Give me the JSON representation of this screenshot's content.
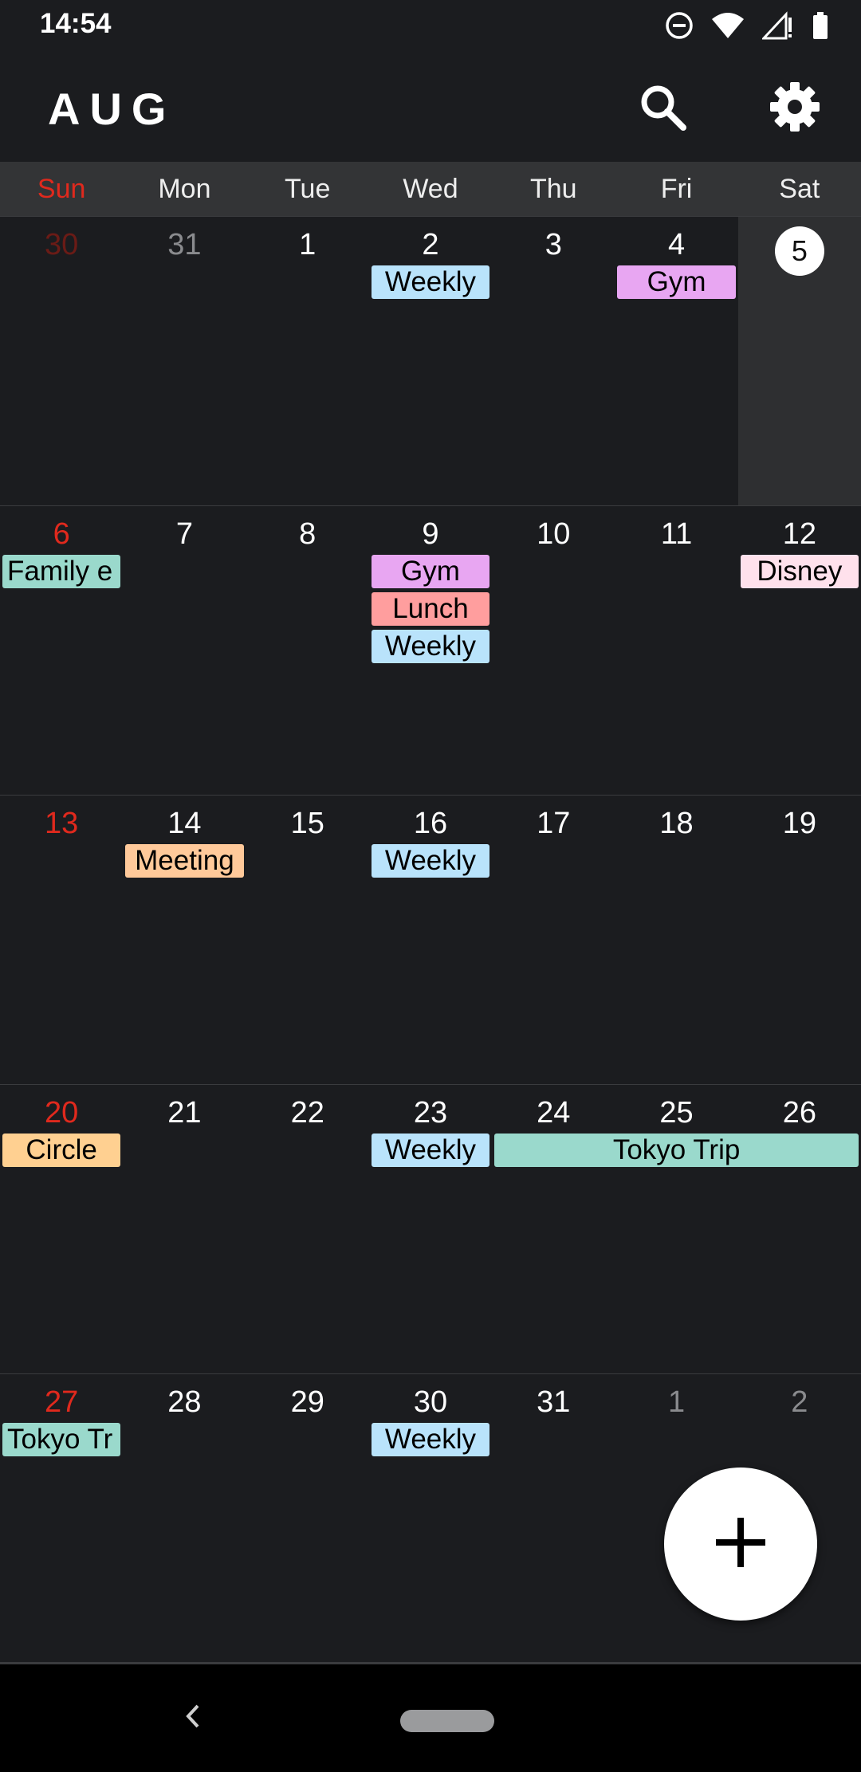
{
  "status_bar": {
    "time": "14:54",
    "icons": [
      "do-not-disturb-icon",
      "wifi-icon",
      "signal-icon",
      "battery-icon"
    ]
  },
  "app_bar": {
    "month": "AUG",
    "search_icon": "search-icon",
    "settings_icon": "gear-icon"
  },
  "weekdays": [
    "Sun",
    "Mon",
    "Tue",
    "Wed",
    "Thu",
    "Fri",
    "Sat"
  ],
  "colors": {
    "background": "#1b1c1f",
    "sunday": "#e0291d",
    "weekly": "#b9e3fb",
    "gym": "#e8a6f2",
    "lunch": "#ff9e9e",
    "meeting": "#ffc99a",
    "circle": "#ffd091",
    "trip": "#9ad9cc",
    "family": "#9ad9cc",
    "disney": "#ffe1ec"
  },
  "weeks": [
    {
      "days": [
        {
          "num": "30",
          "other": true
        },
        {
          "num": "31",
          "other": true
        },
        {
          "num": "1"
        },
        {
          "num": "2"
        },
        {
          "num": "3"
        },
        {
          "num": "4"
        },
        {
          "num": "5",
          "today": true
        }
      ],
      "events": [
        {
          "label": "Weekly",
          "start": 3,
          "span": 1,
          "row": 0,
          "color": "weekly"
        },
        {
          "label": "Gym",
          "start": 5,
          "span": 1,
          "row": 0,
          "color": "gym"
        }
      ]
    },
    {
      "days": [
        {
          "num": "6"
        },
        {
          "num": "7"
        },
        {
          "num": "8"
        },
        {
          "num": "9"
        },
        {
          "num": "10"
        },
        {
          "num": "11"
        },
        {
          "num": "12"
        }
      ],
      "events": [
        {
          "label": "Family e",
          "start": 0,
          "span": 1,
          "row": 0,
          "color": "family",
          "align": "left"
        },
        {
          "label": "Gym",
          "start": 3,
          "span": 1,
          "row": 0,
          "color": "gym"
        },
        {
          "label": "Lunch",
          "start": 3,
          "span": 1,
          "row": 1,
          "color": "lunch"
        },
        {
          "label": "Weekly",
          "start": 3,
          "span": 1,
          "row": 2,
          "color": "weekly"
        },
        {
          "label": "Disney",
          "start": 6,
          "span": 1,
          "row": 0,
          "color": "disney"
        }
      ]
    },
    {
      "days": [
        {
          "num": "13"
        },
        {
          "num": "14"
        },
        {
          "num": "15"
        },
        {
          "num": "16"
        },
        {
          "num": "17"
        },
        {
          "num": "18"
        },
        {
          "num": "19"
        }
      ],
      "events": [
        {
          "label": "Meeting",
          "start": 1,
          "span": 1,
          "row": 0,
          "color": "meeting"
        },
        {
          "label": "Weekly",
          "start": 3,
          "span": 1,
          "row": 0,
          "color": "weekly"
        }
      ]
    },
    {
      "days": [
        {
          "num": "20"
        },
        {
          "num": "21"
        },
        {
          "num": "22"
        },
        {
          "num": "23"
        },
        {
          "num": "24"
        },
        {
          "num": "25"
        },
        {
          "num": "26"
        }
      ],
      "events": [
        {
          "label": "Circle",
          "start": 0,
          "span": 1,
          "row": 0,
          "color": "circle"
        },
        {
          "label": "Weekly",
          "start": 3,
          "span": 1,
          "row": 0,
          "color": "weekly"
        },
        {
          "label": "Tokyo Trip",
          "start": 4,
          "span": 3,
          "row": 0,
          "color": "trip"
        }
      ]
    },
    {
      "days": [
        {
          "num": "27"
        },
        {
          "num": "28"
        },
        {
          "num": "29"
        },
        {
          "num": "30"
        },
        {
          "num": "31"
        },
        {
          "num": "1",
          "other": true
        },
        {
          "num": "2",
          "other": true
        }
      ],
      "events": [
        {
          "label": "Tokyo Tr",
          "start": 0,
          "span": 1,
          "row": 0,
          "color": "trip",
          "align": "left"
        },
        {
          "label": "Weekly",
          "start": 3,
          "span": 1,
          "row": 0,
          "color": "weekly"
        }
      ]
    }
  ],
  "fab": {
    "icon": "plus-icon"
  },
  "nav_bar": {
    "back_icon": "back-chevron-icon",
    "home_icon": "home-pill-icon"
  }
}
